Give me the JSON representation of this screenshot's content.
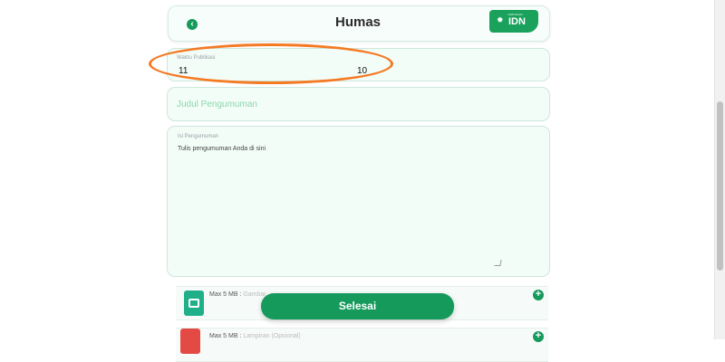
{
  "header": {
    "title": "Humas",
    "back_icon": "chevron-left-icon",
    "logo": {
      "small": "JARINGAN",
      "brand": "IDN",
      "icon": "sun-icon"
    }
  },
  "form": {
    "date": {
      "label": "Waktu Publikasi",
      "value_left": "11",
      "value_right": "10"
    },
    "title": {
      "placeholder": "Judul Pengumuman"
    },
    "content": {
      "label": "Isi Pengumuman",
      "placeholder": "Tulis pengumuman Anda di sini"
    },
    "uploads": [
      {
        "label_prefix": "Max 5 MB : ",
        "label_rest": "Gambar",
        "icon": "image-file-icon"
      },
      {
        "label_prefix": "Max 5 MB : ",
        "label_rest": "Lampiran (Opsional)",
        "icon": "pdf-file-icon"
      }
    ],
    "submit_label": "Selesai",
    "add_symbol": "+"
  },
  "colors": {
    "accent": "#159a5c",
    "highlight": "#f47a24"
  }
}
